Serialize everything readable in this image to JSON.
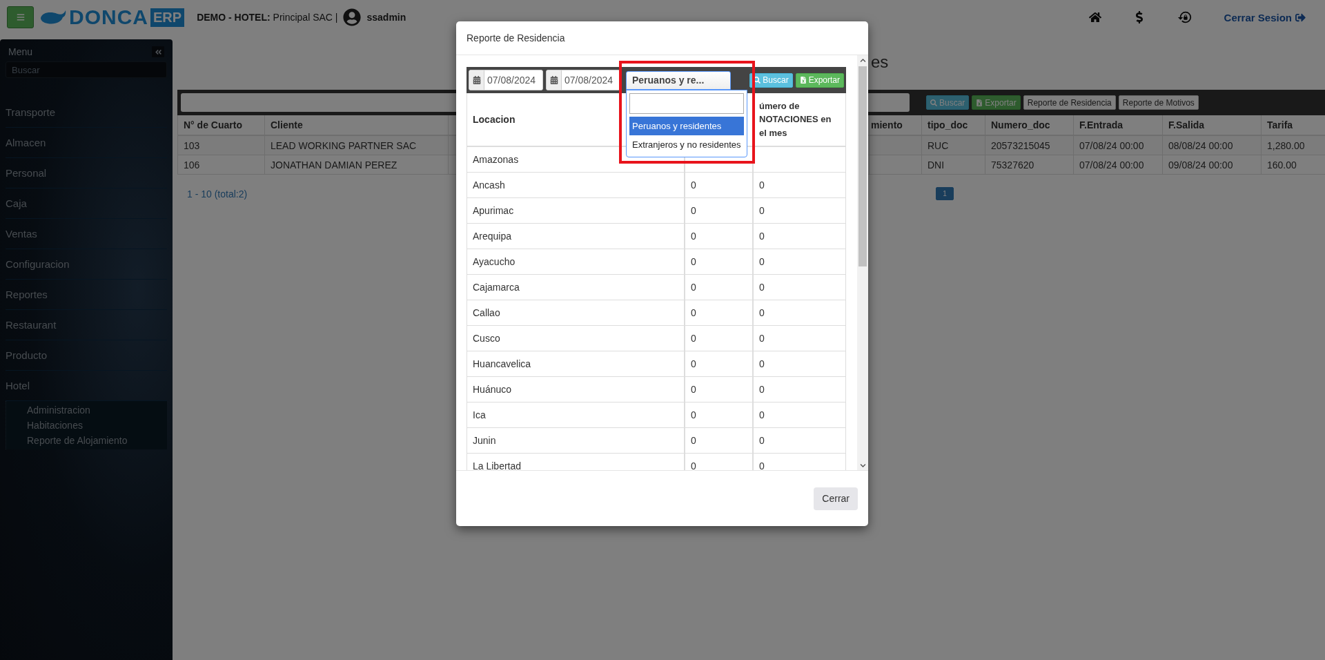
{
  "topbar": {
    "logo": {
      "name": "DONCA",
      "badge": "ERP"
    },
    "company_label": "DEMO - HOTEL:",
    "company": "Principal SAC |",
    "user": "ssadmin",
    "logout": "Cerrar Sesion"
  },
  "sidebar": {
    "title": "Menu",
    "search": {
      "placeholder": "Buscar"
    },
    "items": [
      {
        "label": "Transporte"
      },
      {
        "label": "Almacen"
      },
      {
        "label": "Personal"
      },
      {
        "label": "Caja"
      },
      {
        "label": "Ventas"
      },
      {
        "label": "Configuracion"
      },
      {
        "label": "Reportes"
      },
      {
        "label": "Restaurant"
      },
      {
        "label": "Producto"
      },
      {
        "label": "Hotel",
        "children": [
          {
            "label": "Administracion"
          },
          {
            "label": "Habitaciones"
          },
          {
            "label": "Reporte de Alojamiento"
          }
        ]
      }
    ]
  },
  "page": {
    "title": "es",
    "toolbar": {
      "buttons": [
        {
          "label": "Buscar",
          "kind": "info"
        },
        {
          "label": "Exportar",
          "kind": "success"
        },
        {
          "label": "Reporte de Residencia",
          "kind": "default"
        },
        {
          "label": "Reporte de Motivos",
          "kind": "default"
        }
      ]
    },
    "table": {
      "columns": [
        "N° de Cuarto",
        "Cliente",
        null,
        "miento",
        "tipo_doc",
        "Numero_doc",
        "F.Entrada",
        "F.Salida",
        "Tarifa"
      ],
      "rows": [
        [
          "103",
          "LEAD WORKING PARTNER SAC",
          null,
          null,
          "RUC",
          "20573215045",
          "07/08/24 00:00",
          "08/08/24 00:00",
          "1,280.00"
        ],
        [
          "106",
          "JONATHAN DAMIAN PEREZ",
          null,
          null,
          "DNI",
          "75327620",
          "07/08/24 00:00",
          "09/08/24 00:00",
          "160.00"
        ]
      ]
    },
    "pager": {
      "summary": "1 - 10 (total:2)",
      "pages": [
        {
          "label": "1",
          "selected": true
        }
      ]
    }
  },
  "modal": {
    "title": "Reporte de Residencia",
    "filters": {
      "date_from": "07/08/2024",
      "date_to": "07/08/2024",
      "select": {
        "value": "Peruanos y re...",
        "options": [
          {
            "label": "Peruanos y residentes",
            "selected": true
          },
          {
            "label": "Extranjeros y no residentes",
            "selected": false
          }
        ]
      },
      "buttons": [
        {
          "label": "Buscar",
          "kind": "info"
        },
        {
          "label": "Exportar",
          "kind": "success"
        }
      ]
    },
    "table": {
      "columns": [
        "Locacion",
        null,
        "úmero de NOTACIONES en el mes"
      ],
      "rows": [
        [
          "Amazonas",
          null,
          null
        ],
        [
          "Ancash",
          "0",
          "0"
        ],
        [
          "Apurimac",
          "0",
          "0"
        ],
        [
          "Arequipa",
          "0",
          "0"
        ],
        [
          "Ayacucho",
          "0",
          "0"
        ],
        [
          "Cajamarca",
          "0",
          "0"
        ],
        [
          "Callao",
          "0",
          "0"
        ],
        [
          "Cusco",
          "0",
          "0"
        ],
        [
          "Huancavelica",
          "0",
          "0"
        ],
        [
          "Huánuco",
          "0",
          "0"
        ],
        [
          "Ica",
          "0",
          "0"
        ],
        [
          "Junin",
          "0",
          "0"
        ],
        [
          "La Libertad",
          "0",
          "0"
        ]
      ]
    },
    "footer_button": "Cerrar"
  }
}
